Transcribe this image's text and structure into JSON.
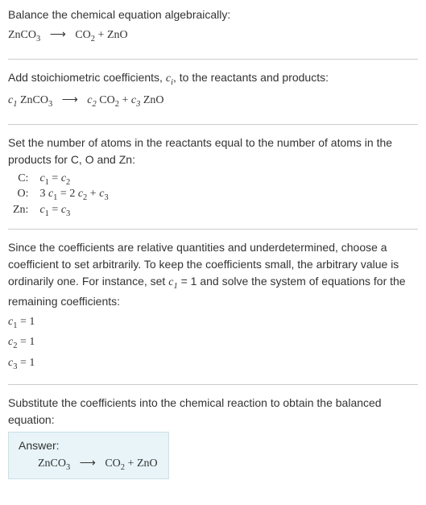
{
  "section1": {
    "title": "Balance the chemical equation algebraically:",
    "eq_left": "ZnCO",
    "eq_left_sub": "3",
    "arrow": "⟶",
    "eq_r1": "CO",
    "eq_r1_sub": "2",
    "plus": " + ",
    "eq_r2": "ZnO"
  },
  "section2": {
    "title_a": "Add stoichiometric coefficients, ",
    "coef_var": "c",
    "coef_sub": "i",
    "title_b": ", to the reactants and products:",
    "c1": "c",
    "c1_sub": "1",
    "sp1": " ZnCO",
    "sp1_sub": "3",
    "arrow": "⟶",
    "c2": "c",
    "c2_sub": "2",
    "sp2": " CO",
    "sp2_sub": "2",
    "plus": " + ",
    "c3": "c",
    "c3_sub": "3",
    "sp3": " ZnO"
  },
  "section3": {
    "title": "Set the number of atoms in the reactants equal to the number of atoms in the products for C, O and Zn:",
    "rows": [
      {
        "label": "C:",
        "lhs_c": "c",
        "lhs_sub": "1",
        "eq": " = ",
        "rhs_c": "c",
        "rhs_sub": "2"
      },
      {
        "label": "O:",
        "lhs_pre": "3 ",
        "lhs_c": "c",
        "lhs_sub": "1",
        "eq": " = 2 ",
        "mid_c": "c",
        "mid_sub": "2",
        "plus": " + ",
        "rhs_c": "c",
        "rhs_sub": "3"
      },
      {
        "label": "Zn:",
        "lhs_c": "c",
        "lhs_sub": "1",
        "eq": " = ",
        "rhs_c": "c",
        "rhs_sub": "3"
      }
    ]
  },
  "section4": {
    "text_a": "Since the coefficients are relative quantities and underdetermined, choose a coefficient to set arbitrarily. To keep the coefficients small, the arbitrary value is ordinarily one. For instance, set ",
    "cvar": "c",
    "csub": "1",
    "text_b": " = 1 and solve the system of equations for the remaining coefficients:",
    "coeffs": [
      {
        "c": "c",
        "sub": "1",
        "val": " = 1"
      },
      {
        "c": "c",
        "sub": "2",
        "val": " = 1"
      },
      {
        "c": "c",
        "sub": "3",
        "val": " = 1"
      }
    ]
  },
  "section5": {
    "title": "Substitute the coefficients into the chemical reaction to obtain the balanced equation:",
    "answer_label": "Answer:",
    "eq_left": "ZnCO",
    "eq_left_sub": "3",
    "arrow": "⟶",
    "eq_r1": "CO",
    "eq_r1_sub": "2",
    "plus": " + ",
    "eq_r2": "ZnO"
  }
}
